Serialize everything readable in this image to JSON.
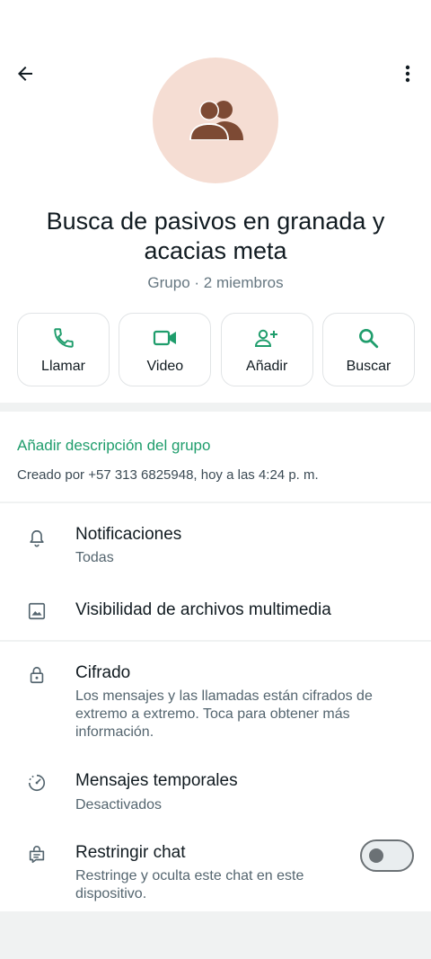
{
  "header": {
    "back_icon": "arrow-left-icon",
    "more_icon": "more-vert-icon"
  },
  "group": {
    "name": "Busca de pasivos en granada y acacias meta",
    "subtitle": "Grupo · 2 miembros",
    "avatar_icon": "group-icon",
    "avatar_bg": "#f5ddd3",
    "avatar_fg": "#7d4a34"
  },
  "actions": [
    {
      "label": "Llamar",
      "icon": "phone-icon"
    },
    {
      "label": "Video",
      "icon": "video-icon"
    },
    {
      "label": "Añadir",
      "icon": "add-person-icon"
    },
    {
      "label": "Buscar",
      "icon": "search-icon"
    }
  ],
  "description": {
    "link": "Añadir descripción del grupo",
    "created": "Creado por +57 313 6825948, hoy a las 4:24 p. m."
  },
  "settings": {
    "notifications": {
      "title": "Notificaciones",
      "subtitle": "Todas",
      "icon": "bell-icon"
    },
    "media": {
      "title": "Visibilidad de archivos multimedia",
      "icon": "image-icon"
    },
    "encryption": {
      "title": "Cifrado",
      "subtitle": "Los mensajes y las llamadas están cifrados de extremo a extremo. Toca para obtener más información.",
      "icon": "lock-icon"
    },
    "disappearing": {
      "title": "Mensajes temporales",
      "subtitle": "Desactivados",
      "icon": "timer-icon"
    },
    "restrict": {
      "title": "Restringir chat",
      "subtitle": "Restringe y oculta este chat en este dispositivo.",
      "icon": "chat-lock-icon",
      "toggle_on": false
    }
  },
  "colors": {
    "accent": "#1f9d6c",
    "background": "#f0f2f2"
  }
}
